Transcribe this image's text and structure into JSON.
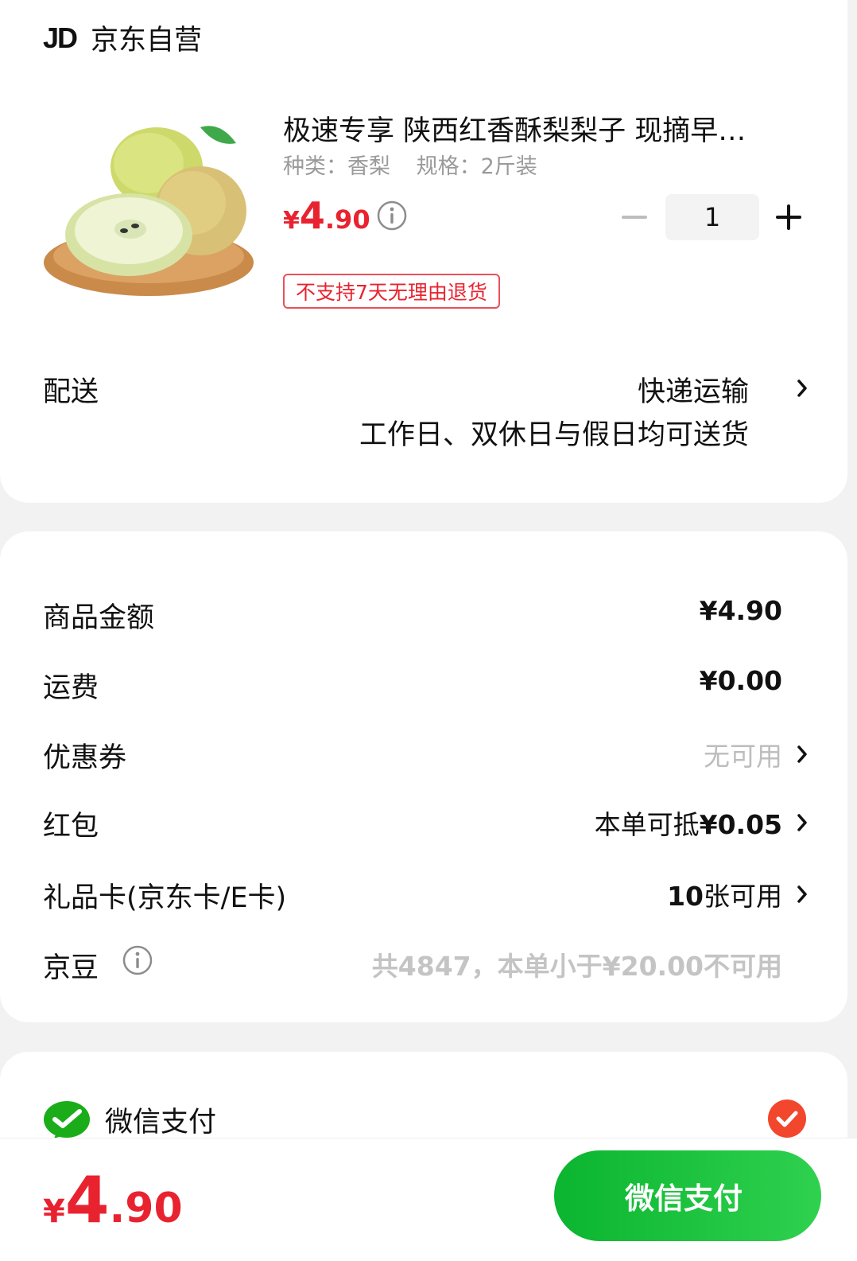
{
  "shop": {
    "logo_text": "JD",
    "name": "京东自营"
  },
  "product": {
    "title": "极速专享 陕西红香酥梨梨子 现摘早…",
    "spec_type": "种类：香梨",
    "spec_size": "规格：2斤装",
    "price_currency": "¥",
    "price_int": "4",
    "price_dec": ".90",
    "quantity": "1",
    "no_return_tag": "不支持7天无理由退货"
  },
  "delivery": {
    "label": "配送",
    "method": "快递运输",
    "note": "工作日、双休日与假日均可送货"
  },
  "costs": {
    "goods_label": "商品金额",
    "goods_value": "¥4.90",
    "shipping_label": "运费",
    "shipping_value": "¥0.00",
    "coupon_label": "优惠券",
    "coupon_value": "无可用",
    "redpacket_label": "红包",
    "redpacket_prefix": "本单可抵",
    "redpacket_amount": "¥0.05",
    "giftcard_label": "礼品卡(京东卡/E卡)",
    "giftcard_count": "10",
    "giftcard_suffix": "张可用",
    "jingdou_label": "京豆",
    "jingdou_value": "共4847，本单小于¥20.00不可用"
  },
  "payment": {
    "method_label": "微信支付",
    "selected": true
  },
  "footer": {
    "total_currency": "¥",
    "total_int": "4",
    "total_dec": ".90",
    "pay_button_label": "微信支付"
  },
  "colors": {
    "price_red": "#e8232f",
    "wechat_green": "#1aad19",
    "check_red": "#f2462d"
  },
  "icons": {
    "info": "info-circle-icon",
    "chevron": "chevron-right-icon",
    "wechat": "wechat-pay-icon",
    "check": "check-circle-icon"
  }
}
